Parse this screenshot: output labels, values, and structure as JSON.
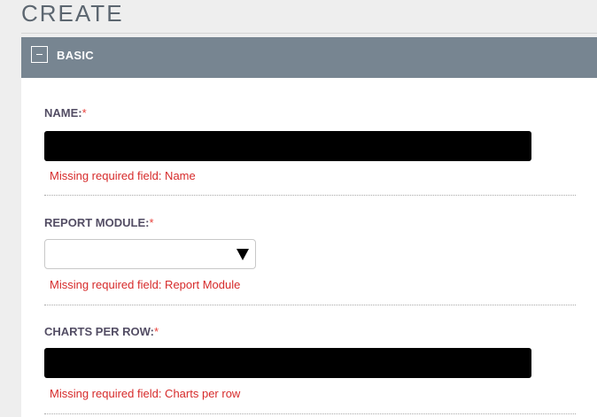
{
  "page": {
    "title": "CREATE"
  },
  "panel": {
    "header_label": "BASIC",
    "collapse_symbol": "−"
  },
  "fields": {
    "name": {
      "label": "NAME:",
      "required_mark": "*",
      "error": "Missing required field: Name"
    },
    "report_module": {
      "label": "REPORT MODULE:",
      "required_mark": "*",
      "selected": "",
      "error": "Missing required field: Report Module"
    },
    "charts_per_row": {
      "label": "CHARTS PER ROW:",
      "required_mark": "*",
      "error": "Missing required field: Charts per row"
    }
  },
  "colors": {
    "header_bg": "#778591",
    "label": "#534d64",
    "required": "#e8403a",
    "error": "#d62a2a"
  },
  "icons": {
    "collapse": "minus-icon",
    "dropdown": "caret-down-icon"
  }
}
